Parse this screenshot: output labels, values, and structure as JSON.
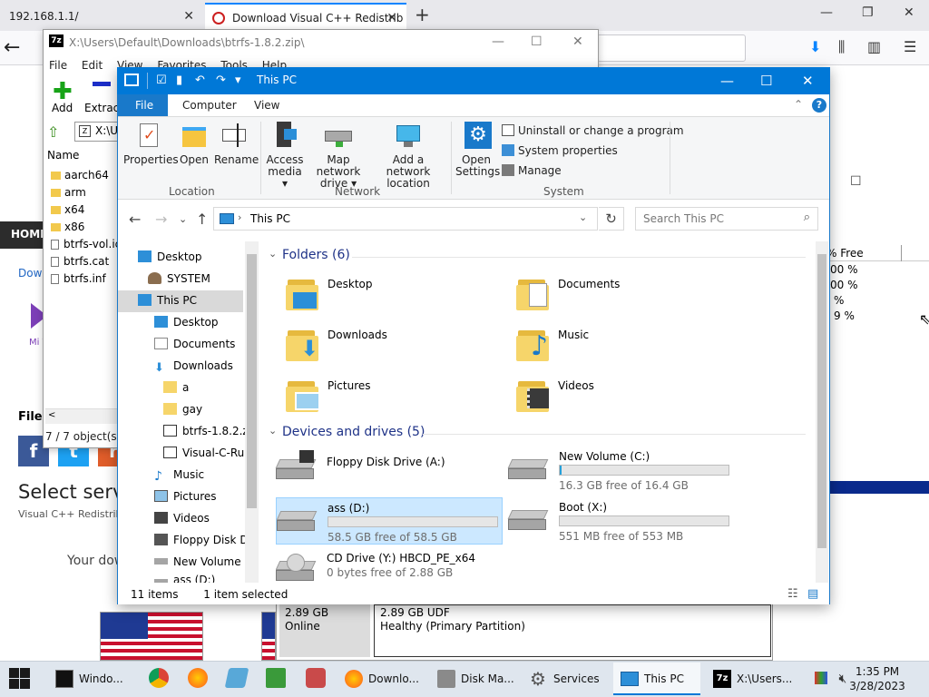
{
  "browser": {
    "tabs": [
      {
        "label": "192.168.1.1/"
      },
      {
        "label": "Download Visual C++ Redistrib"
      }
    ],
    "site": {
      "nav_home": "HOME",
      "download_link": "Dow",
      "logo_text": "Mi Vis",
      "file_heading": "File",
      "select_heading": "Select serv",
      "subtitle": "Visual C++ Redistrib",
      "your_download": "Your dow",
      "social": {
        "facebook": "f",
        "twitter": "t",
        "reddit": "r"
      }
    }
  },
  "diskmgmt": {
    "col_header": "% Free",
    "free_values": [
      "00 %",
      "00 %",
      "%",
      "9 %"
    ],
    "disk_size": "2.89 GB",
    "disk_status": "Online",
    "partition_size": "2.89 GB UDF",
    "partition_health": "Healthy (Primary Partition)"
  },
  "sevenzip": {
    "title": "X:\\Users\\Default\\Downloads\\btrfs-1.8.2.zip\\",
    "logo": "7z",
    "menu": [
      "File",
      "Edit",
      "View",
      "Favorites",
      "Tools",
      "Help"
    ],
    "toolbar": {
      "add": "Add",
      "extract": "Extract"
    },
    "path": "X:\\Us",
    "column_name": "Name",
    "items": [
      {
        "name": "aarch64",
        "type": "folder"
      },
      {
        "name": "arm",
        "type": "folder"
      },
      {
        "name": "x64",
        "type": "folder"
      },
      {
        "name": "x86",
        "type": "folder"
      },
      {
        "name": "btrfs-vol.ic",
        "type": "file"
      },
      {
        "name": "btrfs.cat",
        "type": "file"
      },
      {
        "name": "btrfs.inf",
        "type": "file"
      }
    ],
    "status": "7 / 7 object(s) s"
  },
  "explorer": {
    "title": "This PC",
    "ribbon_tabs": {
      "file": "File",
      "computer": "Computer",
      "view": "View"
    },
    "ribbon": {
      "location": {
        "label": "Location",
        "properties": "Properties",
        "open": "Open",
        "rename": "Rename"
      },
      "network": {
        "label": "Network",
        "access_media": "Access media ▾",
        "map_drive": "Map network drive ▾",
        "add_location": "Add a network location"
      },
      "system": {
        "label": "System",
        "open_settings": "Open Settings",
        "uninstall": "Uninstall or change a program",
        "properties": "System properties",
        "manage": "Manage"
      }
    },
    "address": "This PC",
    "search_placeholder": "Search This PC",
    "nav": [
      {
        "label": "Desktop",
        "indent": 0
      },
      {
        "label": "SYSTEM",
        "indent": 0
      },
      {
        "label": "This PC",
        "indent": 0
      },
      {
        "label": "Desktop",
        "indent": 1
      },
      {
        "label": "Documents",
        "indent": 1
      },
      {
        "label": "Downloads",
        "indent": 1
      },
      {
        "label": "a",
        "indent": 2
      },
      {
        "label": "gay",
        "indent": 2
      },
      {
        "label": "btrfs-1.8.2.zip",
        "indent": 2
      },
      {
        "label": "Visual-C-Run",
        "indent": 2
      },
      {
        "label": "Music",
        "indent": 1
      },
      {
        "label": "Pictures",
        "indent": 1
      },
      {
        "label": "Videos",
        "indent": 1
      },
      {
        "label": "Floppy Disk Dri",
        "indent": 1
      },
      {
        "label": "New Volume (C",
        "indent": 1
      },
      {
        "label": "ass (D:)",
        "indent": 1
      }
    ],
    "folders_header": "Folders (6)",
    "folders": [
      "Desktop",
      "Documents",
      "Downloads",
      "Music",
      "Pictures",
      "Videos"
    ],
    "drives_header": "Devices and drives (5)",
    "drives": [
      {
        "name": "Floppy Disk Drive (A:)",
        "free": "",
        "used": 0
      },
      {
        "name": "New Volume (C:)",
        "free": "16.3 GB free of 16.4 GB",
        "used": 0.01
      },
      {
        "name": "ass (D:)",
        "free": "58.5 GB free of 58.5 GB",
        "used": 0
      },
      {
        "name": "Boot (X:)",
        "free": "551 MB free of 553 MB",
        "used": 0.0
      },
      {
        "name": "CD Drive (Y:) HBCD_PE_x64",
        "free": "0 bytes free of 2.88 GB",
        "used": 1
      }
    ],
    "status_items": "11 items",
    "status_selected": "1 item selected"
  },
  "taskbar": {
    "apps": [
      {
        "label": "Windo..."
      },
      {
        "label": "Downlo..."
      },
      {
        "label": "Disk Ma..."
      },
      {
        "label": "Services"
      },
      {
        "label": "This PC"
      },
      {
        "label": "X:\\Users..."
      }
    ],
    "time": "1:35 PM",
    "date": "3/28/2023"
  }
}
